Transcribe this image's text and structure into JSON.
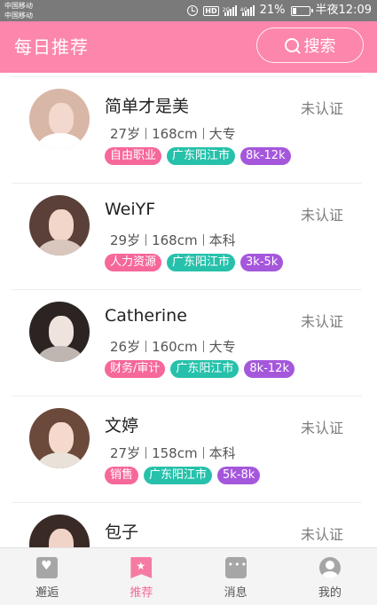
{
  "status_bar": {
    "carrier_1": "中国移动",
    "carrier_2": "中国移动",
    "hd": "HD",
    "net_1": "2G",
    "net_2": "4G",
    "battery": "21%",
    "battery_level": 0.21,
    "time": "半夜12:09"
  },
  "header": {
    "title": "每日推荐",
    "search_label": "搜索",
    "color": "#fc86ac"
  },
  "users": [
    {
      "name": "简单才是美",
      "verify": "未认证",
      "age": "27岁",
      "height": "168cm",
      "edu": "大专",
      "job": "自由职业",
      "location": "广东阳江市",
      "salary": "8k-12k"
    },
    {
      "name": "WeiYF",
      "verify": "未认证",
      "age": "29岁",
      "height": "168cm",
      "edu": "本科",
      "job": "人力资源",
      "location": "广东阳江市",
      "salary": "3k-5k"
    },
    {
      "name": "Catherine",
      "verify": "未认证",
      "age": "26岁",
      "height": "160cm",
      "edu": "大专",
      "job": "财务/审计",
      "location": "广东阳江市",
      "salary": "8k-12k"
    },
    {
      "name": "文婷",
      "verify": "未认证",
      "age": "27岁",
      "height": "158cm",
      "edu": "本科",
      "job": "销售",
      "location": "广东阳江市",
      "salary": "5k-8k"
    },
    {
      "name": "包子",
      "verify": "未认证"
    }
  ],
  "bottom_nav": [
    {
      "label": "邂逅",
      "icon": "heart-card-icon"
    },
    {
      "label": "推荐",
      "icon": "star-bookmark-icon",
      "active": true
    },
    {
      "label": "消息",
      "icon": "chat-bubble-icon"
    },
    {
      "label": "我的",
      "icon": "user-avatar-icon"
    }
  ],
  "colors": {
    "accent": "#fc86ac",
    "tag_job": "#f6679a",
    "tag_location": "#27c1ab",
    "tag_salary": "#a557dc"
  }
}
